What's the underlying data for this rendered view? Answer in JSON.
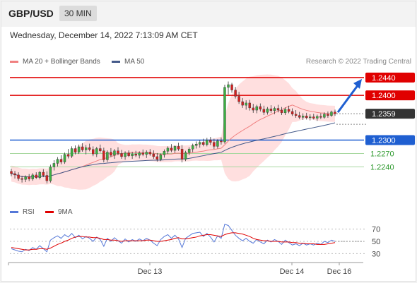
{
  "header": {
    "symbol": "GBP/USD",
    "timeframe": "30 MIN"
  },
  "date_line": "Wednesday, December 14, 2022 7:13:09 AM CET",
  "legend": {
    "ma20_label": "MA 20 + Bollinger Bands",
    "ma50_label": "MA 50",
    "credit": "Research © 2022 Trading Central"
  },
  "rsi_legend": {
    "rsi_label": "RSI",
    "ma_label": "9MA"
  },
  "colors": {
    "red": "#e00000",
    "blue": "#1f5fd1",
    "green": "#2e9a2e",
    "band": "#ffd7d7",
    "ma20": "#f08080",
    "ma50": "#445a8a",
    "rsi": "#5578d8",
    "rsi_ma": "#e00000",
    "price_box": "#333333"
  },
  "chart_data": {
    "type": "candlestick",
    "ylim": [
      1.2165,
      1.2465
    ],
    "x_ticks": [
      "Dec 13",
      "Dec 14",
      "Dec 16"
    ],
    "current_price": "1.2359",
    "levels": [
      {
        "value": 1.244,
        "label": "1.2440",
        "style": "red-box"
      },
      {
        "value": 1.24,
        "label": "1.2400",
        "style": "red-box"
      },
      {
        "value": 1.23,
        "label": "1.2300",
        "style": "blue-box"
      },
      {
        "value": 1.227,
        "label": "1.2270",
        "style": "green-text"
      },
      {
        "value": 1.224,
        "label": "1.2240",
        "style": "green-text"
      }
    ],
    "ohlc": [
      [
        1.223,
        1.2236,
        1.2219,
        1.2225
      ],
      [
        1.2225,
        1.2231,
        1.2214,
        1.2222
      ],
      [
        1.2222,
        1.2228,
        1.2209,
        1.2214
      ],
      [
        1.2214,
        1.222,
        1.2205,
        1.2212
      ],
      [
        1.2212,
        1.2221,
        1.2206,
        1.2218
      ],
      [
        1.2218,
        1.2224,
        1.2208,
        1.2213
      ],
      [
        1.2213,
        1.2226,
        1.2209,
        1.2222
      ],
      [
        1.2222,
        1.2228,
        1.2213,
        1.2216
      ],
      [
        1.2216,
        1.2231,
        1.2212,
        1.2228
      ],
      [
        1.2228,
        1.2235,
        1.2217,
        1.2221
      ],
      [
        1.2221,
        1.223,
        1.2203,
        1.2209
      ],
      [
        1.2209,
        1.2245,
        1.2205,
        1.224
      ],
      [
        1.224,
        1.2255,
        1.2232,
        1.2248
      ],
      [
        1.2248,
        1.2262,
        1.2241,
        1.2257
      ],
      [
        1.2257,
        1.2266,
        1.2246,
        1.2251
      ],
      [
        1.2251,
        1.2272,
        1.2247,
        1.2268
      ],
      [
        1.2268,
        1.228,
        1.2259,
        1.2264
      ],
      [
        1.2264,
        1.2286,
        1.226,
        1.2281
      ],
      [
        1.2281,
        1.2288,
        1.2268,
        1.2273
      ],
      [
        1.2273,
        1.229,
        1.2269,
        1.2285
      ],
      [
        1.2285,
        1.2293,
        1.2274,
        1.2278
      ],
      [
        1.2278,
        1.2289,
        1.2268,
        1.2283
      ],
      [
        1.2283,
        1.2292,
        1.2275,
        1.2279
      ],
      [
        1.2279,
        1.2286,
        1.2264,
        1.2269
      ],
      [
        1.2269,
        1.2285,
        1.2262,
        1.2281
      ],
      [
        1.2281,
        1.229,
        1.2272,
        1.2276
      ],
      [
        1.2276,
        1.2283,
        1.225,
        1.2256
      ],
      [
        1.2256,
        1.2277,
        1.2251,
        1.2273
      ],
      [
        1.2273,
        1.2282,
        1.2262,
        1.2266
      ],
      [
        1.2266,
        1.228,
        1.2258,
        1.2276
      ],
      [
        1.2276,
        1.2284,
        1.2266,
        1.227
      ],
      [
        1.227,
        1.2278,
        1.2258,
        1.2263
      ],
      [
        1.2263,
        1.2275,
        1.2256,
        1.2271
      ],
      [
        1.2271,
        1.2277,
        1.2262,
        1.2265
      ],
      [
        1.2265,
        1.2274,
        1.2258,
        1.2269
      ],
      [
        1.2269,
        1.2276,
        1.2262,
        1.2266
      ],
      [
        1.2266,
        1.2275,
        1.2259,
        1.2271
      ],
      [
        1.2271,
        1.2279,
        1.2264,
        1.2268
      ],
      [
        1.2268,
        1.2277,
        1.226,
        1.2273
      ],
      [
        1.2273,
        1.228,
        1.2265,
        1.2269
      ],
      [
        1.2269,
        1.2277,
        1.2258,
        1.2263
      ],
      [
        1.2263,
        1.2271,
        1.2252,
        1.2257
      ],
      [
        1.2257,
        1.227,
        1.2253,
        1.2267
      ],
      [
        1.2267,
        1.2279,
        1.2261,
        1.2275
      ],
      [
        1.2275,
        1.2286,
        1.2269,
        1.2282
      ],
      [
        1.2282,
        1.2291,
        1.2273,
        1.2277
      ],
      [
        1.2277,
        1.2288,
        1.2271,
        1.2286
      ],
      [
        1.2286,
        1.2294,
        1.2276,
        1.228
      ],
      [
        1.228,
        1.2289,
        1.225,
        1.2257
      ],
      [
        1.2257,
        1.2276,
        1.2253,
        1.2272
      ],
      [
        1.2272,
        1.2284,
        1.2266,
        1.228
      ],
      [
        1.228,
        1.2292,
        1.2273,
        1.2288
      ],
      [
        1.2288,
        1.2297,
        1.2281,
        1.2291
      ],
      [
        1.2291,
        1.23,
        1.2283,
        1.2295
      ],
      [
        1.2295,
        1.2303,
        1.2286,
        1.229
      ],
      [
        1.229,
        1.2305,
        1.2286,
        1.23
      ],
      [
        1.23,
        1.2307,
        1.2289,
        1.2295
      ],
      [
        1.2295,
        1.2303,
        1.228,
        1.2286
      ],
      [
        1.2286,
        1.2302,
        1.2281,
        1.2298
      ],
      [
        1.2298,
        1.2306,
        1.229,
        1.2296
      ],
      [
        1.2296,
        1.2424,
        1.2292,
        1.2418
      ],
      [
        1.2418,
        1.2431,
        1.2402,
        1.2424
      ],
      [
        1.2424,
        1.2428,
        1.2406,
        1.2412
      ],
      [
        1.2412,
        1.2419,
        1.2393,
        1.2398
      ],
      [
        1.2398,
        1.2408,
        1.2381,
        1.2386
      ],
      [
        1.2386,
        1.2394,
        1.2372,
        1.2378
      ],
      [
        1.2378,
        1.2389,
        1.2368,
        1.2383
      ],
      [
        1.2383,
        1.239,
        1.2366,
        1.2372
      ],
      [
        1.2372,
        1.2381,
        1.2361,
        1.2367
      ],
      [
        1.2367,
        1.2379,
        1.236,
        1.2375
      ],
      [
        1.2375,
        1.2382,
        1.2364,
        1.2369
      ],
      [
        1.2369,
        1.2377,
        1.2356,
        1.2362
      ],
      [
        1.2362,
        1.2374,
        1.2357,
        1.237
      ],
      [
        1.237,
        1.2378,
        1.2361,
        1.2366
      ],
      [
        1.2366,
        1.2375,
        1.2358,
        1.2371
      ],
      [
        1.2371,
        1.2379,
        1.2362,
        1.2367
      ],
      [
        1.2367,
        1.2374,
        1.2356,
        1.2361
      ],
      [
        1.2361,
        1.2373,
        1.2356,
        1.2369
      ],
      [
        1.2369,
        1.2377,
        1.236,
        1.2364
      ],
      [
        1.2364,
        1.2371,
        1.2354,
        1.2358
      ],
      [
        1.2358,
        1.2367,
        1.235,
        1.2355
      ],
      [
        1.2355,
        1.2363,
        1.2347,
        1.2351
      ],
      [
        1.2351,
        1.236,
        1.2345,
        1.2354
      ],
      [
        1.2354,
        1.2361,
        1.2346,
        1.235
      ],
      [
        1.235,
        1.2358,
        1.2344,
        1.2352
      ],
      [
        1.2352,
        1.2359,
        1.2346,
        1.2349
      ],
      [
        1.2349,
        1.2357,
        1.2343,
        1.2353
      ],
      [
        1.2353,
        1.236,
        1.2347,
        1.2351
      ],
      [
        1.2351,
        1.2362,
        1.2348,
        1.2358
      ],
      [
        1.2358,
        1.2364,
        1.235,
        1.2355
      ],
      [
        1.2355,
        1.2366,
        1.2352,
        1.2363
      ],
      [
        1.2363,
        1.2368,
        1.2354,
        1.2359
      ]
    ],
    "rsi_axis": {
      "min": 20,
      "max": 80,
      "ticks": [
        70,
        50,
        30
      ]
    },
    "rsi": [
      38,
      36,
      34,
      33,
      37,
      35,
      40,
      37,
      43,
      38,
      33,
      52,
      56,
      59,
      55,
      61,
      57,
      63,
      56,
      60,
      54,
      58,
      55,
      50,
      57,
      53,
      42,
      55,
      50,
      56,
      51,
      47,
      54,
      49,
      53,
      50,
      54,
      51,
      55,
      52,
      47,
      43,
      53,
      58,
      61,
      55,
      60,
      54,
      40,
      55,
      59,
      63,
      64,
      65,
      58,
      63,
      57,
      49,
      59,
      55,
      78,
      76,
      68,
      60,
      55,
      51,
      55,
      50,
      47,
      53,
      49,
      46,
      52,
      49,
      53,
      50,
      45,
      52,
      48,
      44,
      46,
      43,
      47,
      44,
      46,
      44,
      47,
      45,
      50,
      48,
      52,
      50
    ],
    "rsi_ma": [
      40,
      39,
      38,
      37,
      36,
      36,
      37,
      37,
      38,
      38,
      37,
      39,
      42,
      45,
      47,
      50,
      52,
      55,
      57,
      58,
      58,
      57,
      57,
      56,
      56,
      55,
      53,
      53,
      52,
      52,
      51,
      50,
      51,
      51,
      51,
      51,
      51,
      51,
      52,
      52,
      51,
      50,
      50,
      51,
      52,
      53,
      55,
      56,
      54,
      54,
      55,
      56,
      57,
      59,
      60,
      61,
      61,
      60,
      59,
      58,
      61,
      63,
      64,
      64,
      63,
      62,
      60,
      58,
      55,
      53,
      52,
      51,
      51,
      50,
      50,
      50,
      49,
      49,
      49,
      48,
      48,
      47,
      47,
      46,
      46,
      46,
      45,
      45,
      45,
      46,
      47,
      48
    ]
  }
}
